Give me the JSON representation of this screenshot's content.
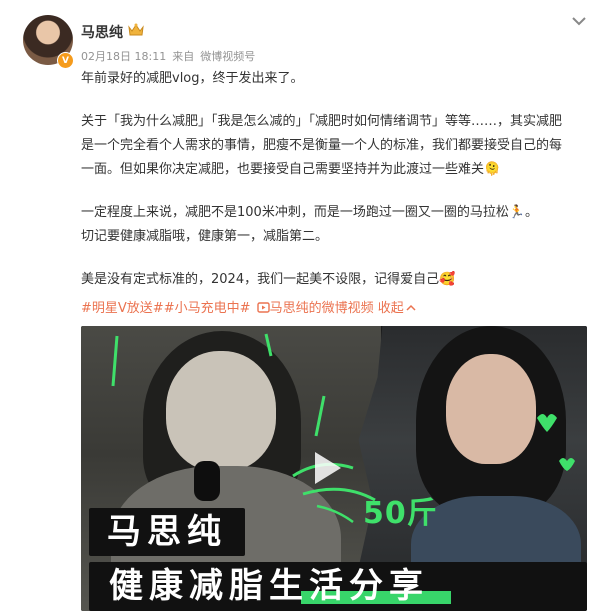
{
  "post": {
    "username": "马思纯",
    "date": "02月18日 18:11",
    "source_prefix": "来自",
    "source": "微博视频号",
    "paragraphs": [
      "年前录好的减肥vlog，终于发出来了。",
      "关于「我为什么减肥」「我是怎么减的」「减肥时如何情绪调节」等等……，其实减肥是一个完全看个人需求的事情，肥瘦不是衡量一个人的标准，我们都要接受自己的每一面。但如果你决定减肥，也要接受自己需要坚持并为此渡过一些难关🫠",
      "一定程度上来说，减肥不是100米冲刺，而是一场跑过一圈又一圈的马拉松🏃。",
      "切记要健康减脂哦，健康第一，减脂第二。",
      "美是没有定式标准的，2024，我们一起美不设限，记得爱自己🥰"
    ],
    "tags": [
      "#明星V放送#",
      "#小马充电中#"
    ],
    "video_link": "马思纯的微博视频",
    "fold_label": "收起"
  },
  "video": {
    "badge": "50斤",
    "title_line1": "马思纯",
    "title_line2": "健康减脂生活分享"
  },
  "icons": {
    "crown": "crown-icon",
    "more": "chevron-down-icon",
    "play": "play-icon",
    "video_link": "video-link-icon",
    "fold": "chevron-up-icon"
  },
  "colors": {
    "accent": "#eb7350",
    "meta_text": "#939393",
    "highlight": "#38d56a"
  }
}
